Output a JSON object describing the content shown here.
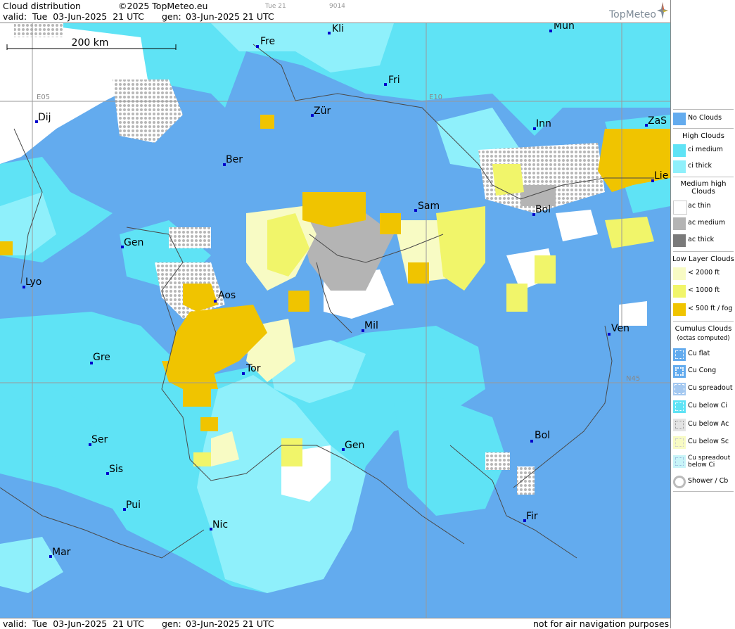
{
  "header": {
    "title": "Cloud distribution",
    "copyright": "©2025 TopMeteo.eu",
    "small_time": "Tue 21",
    "small_code": "9014",
    "valid_label": "valid:",
    "valid_value": "Tue  03-Jun-2025  21 UTC",
    "gen_label": "gen:",
    "gen_value": "03-Jun-2025 21 UTC",
    "logo": "TopMeteo"
  },
  "footer": {
    "valid_label": "valid:",
    "valid_value": "Tue  03-Jun-2025  21 UTC",
    "gen_label": "gen:",
    "gen_value": "03-Jun-2025 21 UTC",
    "disclaimer": "not for air navigation purposes"
  },
  "map": {
    "scale_label": "200 km",
    "grid_labels": [
      "E05",
      "E10",
      "N45"
    ],
    "cities": [
      {
        "name": "Kli"
      },
      {
        "name": "Mün"
      },
      {
        "name": "Fre"
      },
      {
        "name": "Fri"
      },
      {
        "name": "Dij"
      },
      {
        "name": "Zür"
      },
      {
        "name": "Inn"
      },
      {
        "name": "ZaS"
      },
      {
        "name": "Ber"
      },
      {
        "name": "Lie"
      },
      {
        "name": "Sam"
      },
      {
        "name": "Bol"
      },
      {
        "name": "Gen"
      },
      {
        "name": "Lyo"
      },
      {
        "name": "Aos"
      },
      {
        "name": "Mil"
      },
      {
        "name": "Ven"
      },
      {
        "name": "Gre"
      },
      {
        "name": "Tor"
      },
      {
        "name": "Ser"
      },
      {
        "name": "Gen"
      },
      {
        "name": "Bol"
      },
      {
        "name": "Sis"
      },
      {
        "name": "Pui"
      },
      {
        "name": "Nic"
      },
      {
        "name": "Fir"
      },
      {
        "name": "Mar"
      }
    ],
    "colors": {
      "no_clouds": "#63abee",
      "ci_medium": "#5fe3f5",
      "ci_thick": "#8ff0fb",
      "ac_thin": "#ffffff",
      "ac_medium": "#b4b4b4",
      "ac_thick": "#7a7a7a",
      "low_2000": "#f8fbc4",
      "low_1000": "#f1f56a",
      "low_500": "#f0c400"
    }
  },
  "legend": {
    "no_clouds": "No Clouds",
    "high_title": "High Clouds",
    "ci_medium": "ci medium",
    "ci_thick": "ci thick",
    "medium_title": "Medium high Clouds",
    "ac_thin": "ac thin",
    "ac_medium": "ac medium",
    "ac_thick": "ac thick",
    "low_title": "Low Layer Clouds",
    "low_2000": "< 2000 ft",
    "low_1000": "< 1000 ft",
    "low_500": "< 500 ft / fog",
    "cu_title": "Cumulus Clouds",
    "cu_sub": "(octas computed)",
    "cu_flat": "Cu flat",
    "cu_cong": "Cu Cong",
    "cu_spread": "Cu spreadout",
    "cu_below_ci": "Cu below Ci",
    "cu_below_ac": "Cu below Ac",
    "cu_below_sc": "Cu below Sc",
    "cu_spread_ci": "Cu spreadout below Ci",
    "shower": "Shower / Cb"
  }
}
